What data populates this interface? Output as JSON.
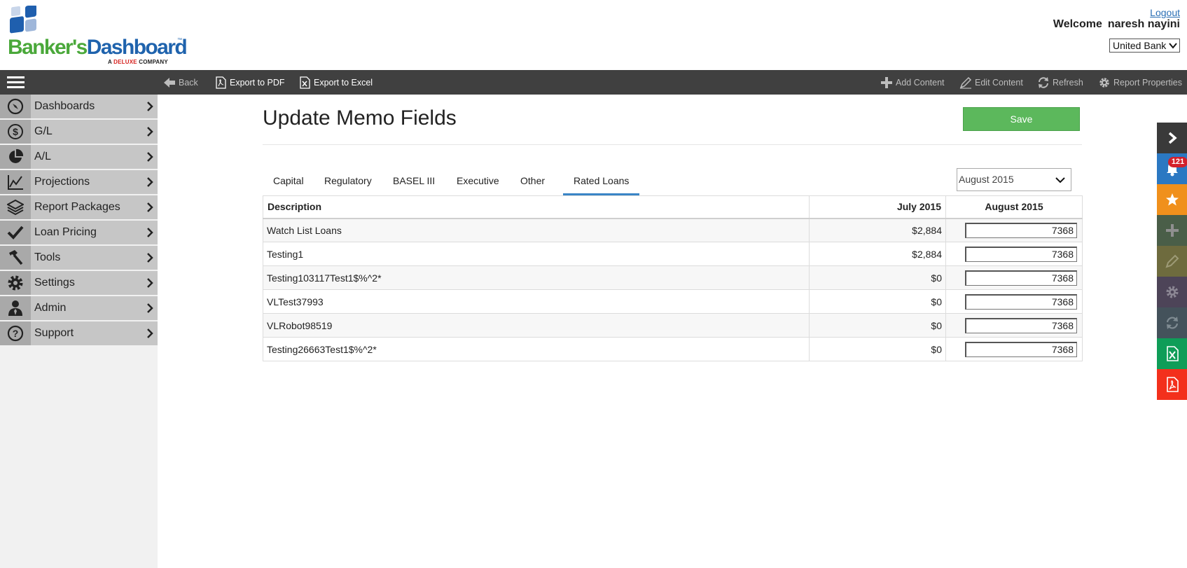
{
  "header": {
    "logo": {
      "name_part1": "Banker's",
      "name_part2": "Dashboard",
      "tm": "™",
      "sub_prefix": "A",
      "sub_brand": "DELUXE",
      "sub_suffix": "COMPANY"
    },
    "logout_label": "Logout",
    "welcome_label": "Welcome",
    "user_name": "naresh nayini",
    "bank_select_value": "United Bank"
  },
  "toolbar": {
    "back_label": "Back",
    "export_pdf_label": "Export to PDF",
    "export_excel_label": "Export to Excel",
    "add_content_label": "Add Content",
    "edit_content_label": "Edit Content",
    "refresh_label": "Refresh",
    "report_properties_label": "Report Properties"
  },
  "sidebar": {
    "items": [
      {
        "label": "Dashboards",
        "icon": "compass-icon"
      },
      {
        "label": "G/L",
        "icon": "dollar-icon"
      },
      {
        "label": "A/L",
        "icon": "pie-chart-icon"
      },
      {
        "label": "Projections",
        "icon": "line-chart-icon"
      },
      {
        "label": "Report Packages",
        "icon": "layers-icon"
      },
      {
        "label": "Loan Pricing",
        "icon": "check-icon"
      },
      {
        "label": "Tools",
        "icon": "hammer-icon"
      },
      {
        "label": "Settings",
        "icon": "gear-icon"
      },
      {
        "label": "Admin",
        "icon": "user-tie-icon"
      },
      {
        "label": "Support",
        "icon": "question-icon"
      }
    ]
  },
  "main": {
    "title": "Update Memo Fields",
    "save_label": "Save",
    "tabs": [
      {
        "label": "Capital"
      },
      {
        "label": "Regulatory"
      },
      {
        "label": "BASEL III"
      },
      {
        "label": "Executive"
      },
      {
        "label": "Other"
      },
      {
        "label": "Rated Loans",
        "active": true
      }
    ],
    "month_select_value": "August 2015",
    "table": {
      "headers": [
        "Description",
        "July 2015",
        "August 2015"
      ],
      "rows": [
        {
          "description": "Watch List Loans",
          "july": "$2,884",
          "august": "7368"
        },
        {
          "description": "Testing1",
          "july": "$2,884",
          "august": "7368"
        },
        {
          "description": "Testing103117Test1$%^2*",
          "july": "$0",
          "august": "7368"
        },
        {
          "description": "VLTest37993",
          "july": "$0",
          "august": "7368"
        },
        {
          "description": "VLRobot98519",
          "july": "$0",
          "august": "7368"
        },
        {
          "description": "Testing26663Test1$%^2*",
          "july": "$0",
          "august": "7368"
        }
      ]
    }
  },
  "rail": {
    "notification_count": "121",
    "buttons": [
      {
        "icon": "chevron-right-icon",
        "color": "#3a3a3a"
      },
      {
        "icon": "bell-icon",
        "color": "#2b78c2"
      },
      {
        "icon": "star-icon",
        "color": "#f0901c"
      },
      {
        "icon": "plus-icon",
        "color": "#4a5e48"
      },
      {
        "icon": "pencil-icon",
        "color": "#6e6b3e"
      },
      {
        "icon": "gear-icon",
        "color": "#4d4458"
      },
      {
        "icon": "refresh-icon",
        "color": "#44525b"
      },
      {
        "icon": "excel-icon",
        "color": "#0f9d58"
      },
      {
        "icon": "pdf-icon",
        "color": "#f3301c"
      }
    ]
  }
}
